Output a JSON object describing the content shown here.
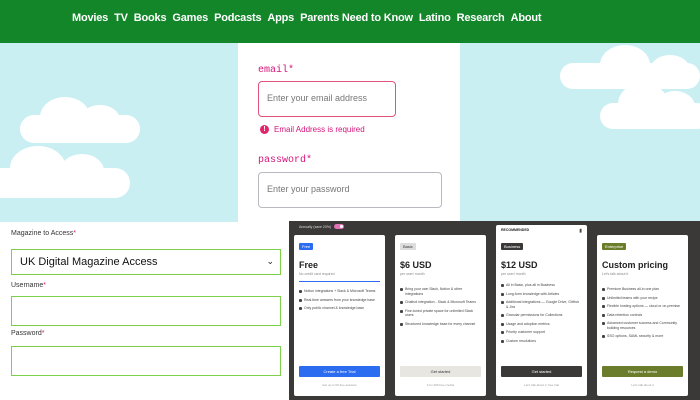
{
  "nav": {
    "items": [
      "Movies",
      "TV",
      "Books",
      "Games",
      "Podcasts",
      "Apps",
      "Parents Need to Know",
      "Latino",
      "Research",
      "About"
    ]
  },
  "login": {
    "email_label": "email",
    "email_placeholder": "Enter your email address",
    "email_error": "Email Address is required",
    "password_label": "password",
    "password_placeholder": "Enter your password",
    "required_mark": "*"
  },
  "magazine_form": {
    "access_label": "Magazine to Access",
    "access_value": "UK Digital Magazine Access",
    "username_label": "Username",
    "password_label": "Password",
    "required_mark": "*"
  },
  "pricing": {
    "toggle_text": "Annually (save 20%)",
    "plans": [
      {
        "badge": "Free",
        "name": "Free",
        "subtitle": "No credit card required",
        "features": [
          "Notion integrations + Slack & Microsoft Teams",
          "Real-time answers from your knowledge base",
          "Only public channel & knowledge base"
        ],
        "button": "Create a free Trial",
        "footnote": "Get up to 50 free answers"
      },
      {
        "badge": "Basic",
        "name": "$6 USD",
        "subtitle": "per user/ month",
        "features": [
          "Bring your own Slack, Notion & other integrations",
          "Chatbot integration - Slack & Microsoft Teams",
          "Fine-tuned private space for unlimited Slack users",
          "Structured knowledge base for every channel"
        ],
        "button": "Get started",
        "footnote": "2 for 200 free credits"
      },
      {
        "top_label": "RECOMMENDED",
        "badge": "Business",
        "name": "$12 USD",
        "subtitle": "per user/ month",
        "features": [
          "All in Basic, plus all in Business",
          "Long-form knowledge with Articles",
          "Additional integrations — Google Drive, GitHub & Jira",
          "Granular permissions for Collections",
          "Usage and adoption metrics",
          "Priority customer support",
          "Custom resolutions"
        ],
        "button": "Get started",
        "footnote": "Let's talk about it, free trial"
      },
      {
        "badge": "Enterprise",
        "name": "Custom pricing",
        "subtitle": "Let's talk about it",
        "features": [
          "Premium Business all-in one plan",
          "Unlimited teams with your recipe",
          "Flexible hosting options — cloud or on-premise",
          "Data retention controls",
          "Advanced customer success and Community building resources",
          "SSO options, SAML security & more"
        ],
        "button": "Request a demo",
        "footnote": "Let's talk about it"
      }
    ]
  },
  "colors": {
    "nav_green": "#13862a",
    "sky": "#c9eff3",
    "error_pink": "#d4167a",
    "form_green_border": "#7cd04a",
    "pricing_bg": "#3b3838",
    "free_blue": "#2c6cf0",
    "enterprise_olive": "#6b7d2a"
  }
}
